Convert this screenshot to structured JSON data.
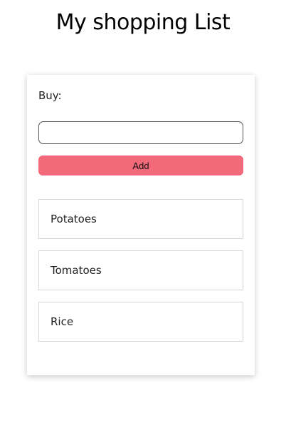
{
  "page": {
    "title": "My shopping List"
  },
  "form": {
    "buy_label": "Buy:",
    "input_value": "",
    "input_placeholder": "",
    "add_label": "Add"
  },
  "list": {
    "items": [
      {
        "label": "Potatoes"
      },
      {
        "label": "Tomatoes"
      },
      {
        "label": "Rice"
      }
    ]
  },
  "colors": {
    "accent": "#f2697a",
    "border": "#d6d6d6",
    "background": "#ffffff"
  }
}
